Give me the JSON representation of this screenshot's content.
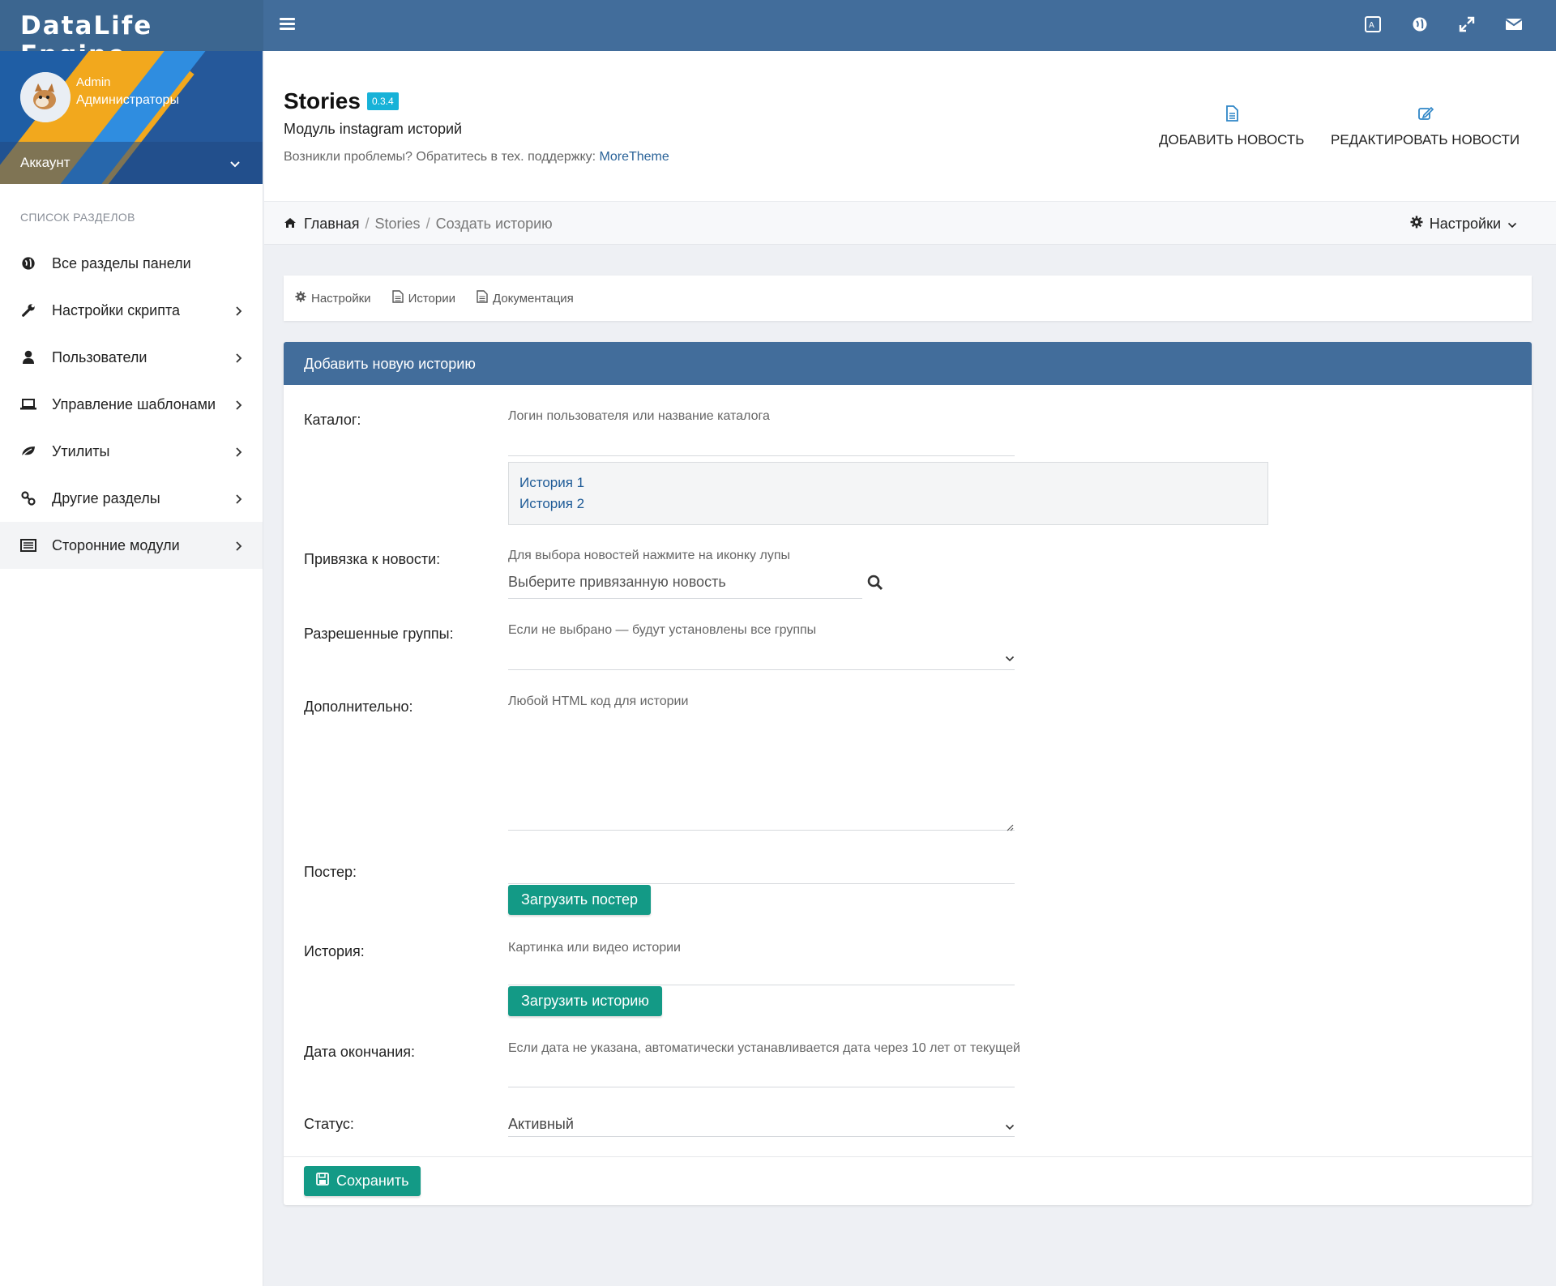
{
  "navbar": {
    "brand": "DataLife Engine",
    "icons": [
      "translate-icon",
      "globe-icon",
      "fullscreen-icon",
      "envelope-icon"
    ]
  },
  "sidebar": {
    "user_role": "Admin",
    "user_group": "Администраторы",
    "account_label": "Аккаунт",
    "section_title": "СПИСОК РАЗДЕЛОВ",
    "items": [
      {
        "label": "Все разделы панели",
        "icon": "globe-icon"
      },
      {
        "label": "Настройки скрипта",
        "icon": "wrench-icon"
      },
      {
        "label": "Пользователи",
        "icon": "user-icon"
      },
      {
        "label": "Управление шаблонами",
        "icon": "laptop-icon"
      },
      {
        "label": "Утилиты",
        "icon": "leaf-icon"
      },
      {
        "label": "Другие разделы",
        "icon": "link-icon"
      },
      {
        "label": "Сторонние модули",
        "icon": "list-icon"
      }
    ]
  },
  "header": {
    "title": "Stories",
    "version": "0.3.4",
    "subtitle": "Модуль instagram историй",
    "support_text": "Возникли проблемы? Обратитесь в тех. поддержку:",
    "support_link": "MoreTheme",
    "actions": {
      "add_news": "ДОБАВИТЬ НОВОСТЬ",
      "edit_news": "РЕДАКТИРОВАТЬ НОВОСТИ"
    }
  },
  "breadcrumb": {
    "home": "Главная",
    "stories": "Stories",
    "current": "Создать историю",
    "settings": "Настройки"
  },
  "tabs": {
    "settings": "Настройки",
    "stories": "Истории",
    "docs": "Документация"
  },
  "form": {
    "title": "Добавить новую историю",
    "catalog": {
      "label": "Каталог:",
      "hint": "Логин пользователя или название каталога",
      "options": [
        "История 1",
        "История 2"
      ]
    },
    "news": {
      "label": "Привязка к новости:",
      "hint": "Для выбора новостей нажмите на иконку лупы",
      "placeholder": "Выберите привязанную новость"
    },
    "groups": {
      "label": "Разрешенные группы:",
      "hint": "Если не выбрано — будут установлены все группы"
    },
    "extra": {
      "label": "Дополнительно:",
      "hint": "Любой HTML код для истории"
    },
    "poster": {
      "label": "Постер:",
      "button": "Загрузить постер"
    },
    "story": {
      "label": "История:",
      "hint": "Картинка или видео истории",
      "button": "Загрузить историю"
    },
    "end_date": {
      "label": "Дата окончания:",
      "hint": "Если дата не указана, автоматически устанавливается дата через 10 лет от текущей"
    },
    "status": {
      "label": "Статус:",
      "value": "Активный"
    },
    "save_button": "Сохранить"
  },
  "colors": {
    "navbar": "#426d9b",
    "accent_green": "#139a86",
    "badge": "#17b2d8",
    "link": "#2a6399"
  }
}
